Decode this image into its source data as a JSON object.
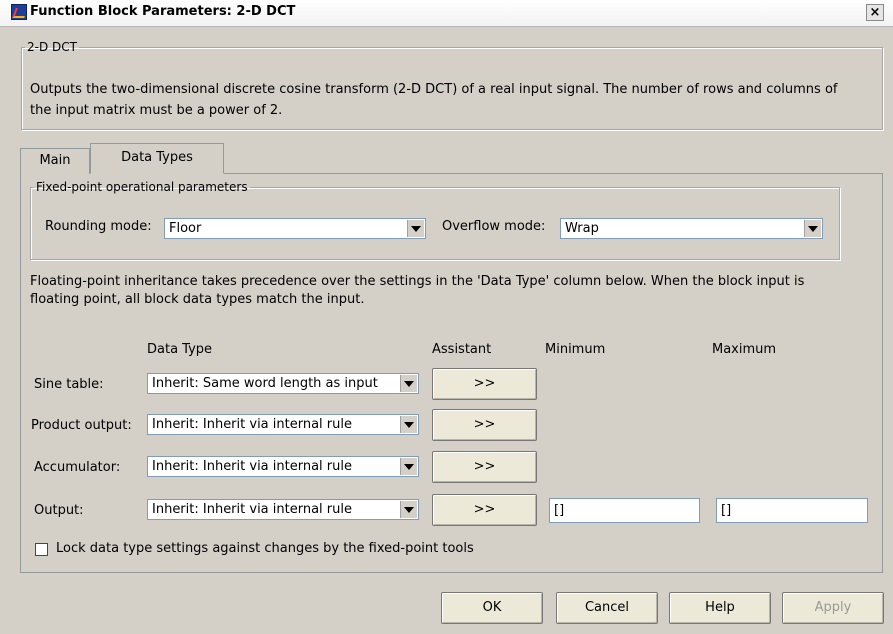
{
  "window": {
    "title": "Function Block Parameters: 2-D DCT",
    "close_glyph": "×"
  },
  "description": {
    "legend": "2-D DCT",
    "line1": "Outputs the two-dimensional discrete cosine transform (2-D DCT) of a real input signal. The number of rows and columns of",
    "line2": "the input matrix must be a power of 2."
  },
  "tabs": [
    {
      "label": "Main",
      "active": false
    },
    {
      "label": "Data Types",
      "active": true
    }
  ],
  "fixed_point": {
    "legend": "Fixed-point operational parameters",
    "rounding_label": "Rounding mode:",
    "rounding_value": "Floor",
    "overflow_label": "Overflow mode:",
    "overflow_value": "Wrap"
  },
  "note": {
    "line1": "Floating-point inheritance takes precedence over the settings in the 'Data Type' column below. When the block input is",
    "line2": "floating point, all block data types match the input."
  },
  "table": {
    "headers": {
      "data_type": "Data Type",
      "assistant": "Assistant",
      "minimum": "Minimum",
      "maximum": "Maximum"
    },
    "rows": [
      {
        "label": "Sine table:",
        "value": "Inherit: Same word length as input",
        "assistant": ">>"
      },
      {
        "label": "Product output:",
        "value": "Inherit: Inherit via internal rule",
        "assistant": ">>"
      },
      {
        "label": "Accumulator:",
        "value": "Inherit: Inherit via internal rule",
        "assistant": ">>"
      },
      {
        "label": "Output:",
        "value": "Inherit: Inherit via internal rule",
        "assistant": ">>",
        "minimum": "[]",
        "maximum": "[]"
      }
    ]
  },
  "lock": {
    "label": "Lock data type settings against changes by the fixed-point tools",
    "checked": false
  },
  "buttons": {
    "ok": "OK",
    "cancel": "Cancel",
    "help": "Help",
    "apply": "Apply"
  }
}
